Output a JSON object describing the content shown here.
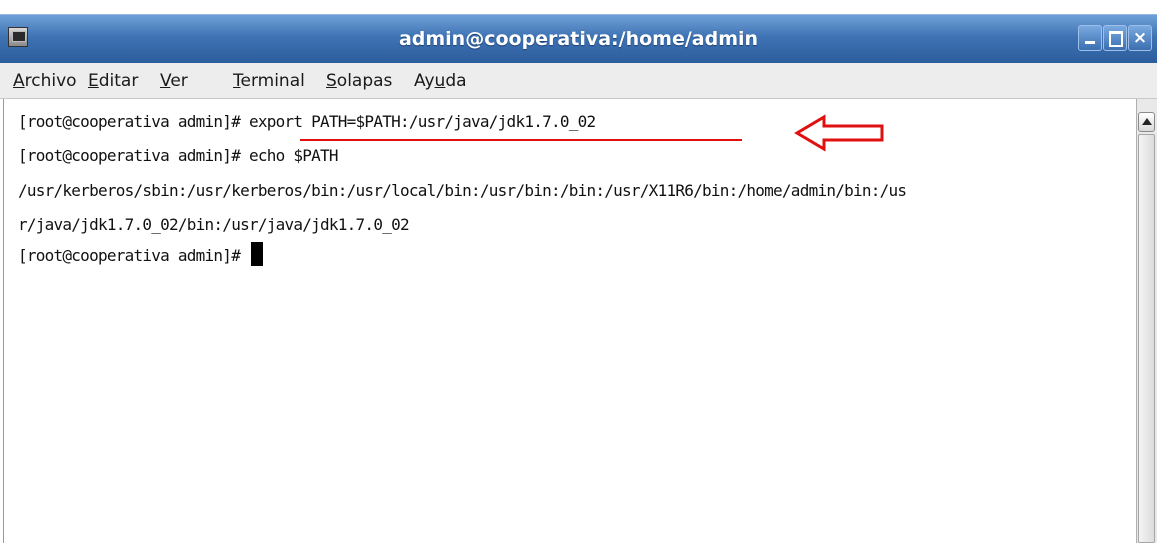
{
  "window": {
    "title": "admin@cooperativa:/home/admin"
  },
  "menu": {
    "items": [
      {
        "pre": "",
        "mn": "A",
        "post": "rchivo"
      },
      {
        "pre": "",
        "mn": "E",
        "post": "ditar"
      },
      {
        "pre": "",
        "mn": "V",
        "post": "er"
      },
      {
        "pre": "",
        "mn": "T",
        "post": "erminal"
      },
      {
        "pre": "",
        "mn": "S",
        "post": "olapas"
      },
      {
        "pre": "Ay",
        "mn": "u",
        "post": "da"
      }
    ]
  },
  "terminal": {
    "lines": [
      "[root@cooperativa admin]# export PATH=$PATH:/usr/java/jdk1.7.0_02",
      "[root@cooperativa admin]# echo $PATH",
      "/usr/kerberos/sbin:/usr/kerberos/bin:/usr/local/bin:/usr/bin:/bin:/usr/X11R6/bin:/home/admin/bin:/us",
      "r/java/jdk1.7.0_02/bin:/usr/java/jdk1.7.0_02",
      "[root@cooperativa admin]# "
    ]
  },
  "annotation": {
    "arrow_color": "#e01010",
    "icon": "left-arrow-icon"
  },
  "colors": {
    "titlebar": "#3f73b4",
    "menubar": "#ededed",
    "terminal_bg": "#ffffff",
    "terminal_fg": "#111111"
  }
}
